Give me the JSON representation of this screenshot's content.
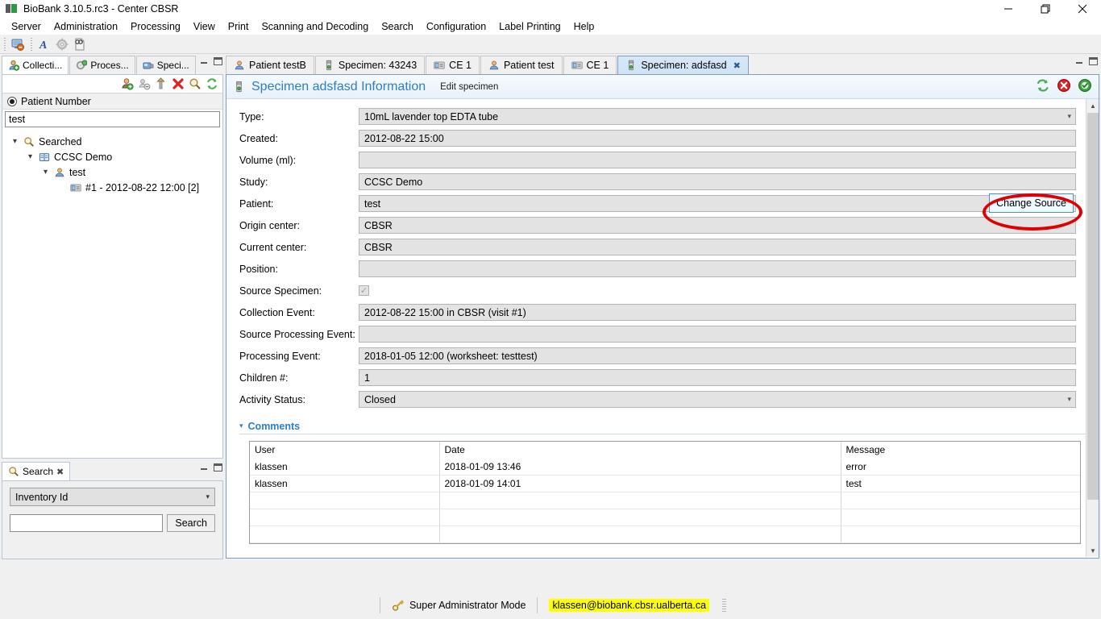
{
  "window": {
    "title": "BioBank 3.10.5.rc3 - Center CBSR",
    "app_icon": "biobank-icon",
    "controls": {
      "minimize": "minimize-icon",
      "restore": "restore-icon",
      "close": "close-icon"
    }
  },
  "menubar": {
    "items": [
      {
        "label": "Server"
      },
      {
        "label": "Administration"
      },
      {
        "label": "Processing"
      },
      {
        "label": "View"
      },
      {
        "label": "Print"
      },
      {
        "label": "Scanning and Decoding"
      },
      {
        "label": "Search"
      },
      {
        "label": "Configuration"
      },
      {
        "label": "Label Printing"
      },
      {
        "label": "Help"
      }
    ]
  },
  "toolbar": {
    "buttons": [
      {
        "icon": "server-connection-icon"
      },
      {
        "icon": "font-style-icon"
      },
      {
        "icon": "gear-settings-icon"
      },
      {
        "icon": "scan-document-icon"
      }
    ]
  },
  "left_panel": {
    "tabs": [
      {
        "label": "Collecti...",
        "icon": "collection-event-icon",
        "active": true
      },
      {
        "label": "Proces...",
        "icon": "processing-icon",
        "active": false
      },
      {
        "label": "Speci...",
        "icon": "specimen-icon",
        "active": false
      }
    ],
    "view_controls": {
      "minimize": "minimize-view-icon",
      "maximize": "maximize-view-icon"
    },
    "panel_toolbar": [
      {
        "icon": "add-patient-icon"
      },
      {
        "icon": "remove-patient-icon"
      },
      {
        "icon": "move-up-icon"
      },
      {
        "icon": "delete-icon"
      },
      {
        "icon": "search-icon"
      },
      {
        "icon": "refresh-icon"
      }
    ],
    "radio": {
      "label": "Patient Number",
      "selected": true
    },
    "search_value": "test",
    "tree": [
      {
        "label": "Searched",
        "icon": "magnifier-icon",
        "depth": 1,
        "expanded": true
      },
      {
        "label": "CCSC Demo",
        "icon": "study-book-icon",
        "depth": 2,
        "expanded": true
      },
      {
        "label": "test",
        "icon": "patient-icon",
        "depth": 3,
        "expanded": true
      },
      {
        "label": "#1 - 2012-08-22 12:00 [2]",
        "icon": "collection-event-small-icon",
        "depth": 4,
        "expanded": false
      }
    ]
  },
  "search_view": {
    "tab": {
      "label": "Search",
      "icon": "search-icon",
      "close": "close-icon"
    },
    "view_controls": {
      "minimize": "minimize-view-icon",
      "maximize": "maximize-view-icon"
    },
    "select_value": "Inventory Id",
    "input_value": "",
    "button_label": "Search"
  },
  "editor": {
    "tabs": [
      {
        "label": "Patient testB",
        "icon": "patient-icon",
        "active": false,
        "closable": false
      },
      {
        "label": "Specimen: 43243",
        "icon": "specimen-icon",
        "active": false,
        "closable": false
      },
      {
        "label": "CE 1",
        "icon": "collection-event-small-icon",
        "active": false,
        "closable": false
      },
      {
        "label": "Patient test",
        "icon": "patient-icon",
        "active": false,
        "closable": false
      },
      {
        "label": "CE 1",
        "icon": "collection-event-small-icon",
        "active": false,
        "closable": false
      },
      {
        "label": "Specimen: adsfasd",
        "icon": "specimen-icon",
        "active": true,
        "closable": true,
        "close_glyph": "✖"
      }
    ],
    "view_controls": {
      "minimize": "minimize-view-icon",
      "maximize": "maximize-view-icon"
    },
    "header": {
      "icon": "specimen-icon",
      "title": "Specimen adsfasd Information",
      "subtitle": "Edit specimen",
      "actions": [
        {
          "icon": "refresh-icon"
        },
        {
          "icon": "delete-red-icon"
        },
        {
          "icon": "ok-green-icon"
        }
      ]
    },
    "fields": [
      {
        "label": "Type:",
        "value": "10mL lavender top EDTA tube",
        "kind": "combo"
      },
      {
        "label": "Created:",
        "value": "2012-08-22 15:00",
        "kind": "text"
      },
      {
        "label": "Volume (ml):",
        "value": "",
        "kind": "text"
      },
      {
        "label": "Study:",
        "value": "CCSC Demo",
        "kind": "text"
      },
      {
        "label": "Patient:",
        "value": "test",
        "kind": "text-with-button",
        "button_label": "Change Source"
      },
      {
        "label": "Origin center:",
        "value": "CBSR",
        "kind": "text"
      },
      {
        "label": "Current center:",
        "value": "CBSR",
        "kind": "text"
      },
      {
        "label": "Position:",
        "value": "",
        "kind": "text"
      },
      {
        "label": "Source Specimen:",
        "value": "",
        "kind": "checkbox",
        "checked": true
      },
      {
        "label": "Collection Event:",
        "value": "2012-08-22 15:00 in CBSR (visit #1)",
        "kind": "text"
      },
      {
        "label": "Source Processing Event:",
        "value": "",
        "kind": "text"
      },
      {
        "label": "Processing Event:",
        "value": "2018-01-05 12:00 (worksheet: testtest)",
        "kind": "text"
      },
      {
        "label": "Children #:",
        "value": "1",
        "kind": "text"
      },
      {
        "label": "Activity Status:",
        "value": "Closed",
        "kind": "combo"
      }
    ],
    "comments_section": {
      "title": "Comments",
      "expanded": true,
      "columns": [
        "User",
        "Date",
        "Message"
      ],
      "rows": [
        [
          "klassen",
          "2018-01-09 13:46",
          "error"
        ],
        [
          "klassen",
          "2018-01-09 14:01",
          "test"
        ],
        [
          "",
          "",
          ""
        ],
        [
          "",
          "",
          ""
        ],
        [
          "",
          "",
          ""
        ]
      ]
    }
  },
  "statusbar": {
    "mode_icon": "key-icon",
    "mode_label": "Super Administrator Mode",
    "email": "klassen@biobank.cbsr.ualberta.ca",
    "email_highlight_color": "#ffff00"
  },
  "annotation": {
    "shape": "ellipse",
    "color": "#e00000",
    "target": "Change Source"
  }
}
